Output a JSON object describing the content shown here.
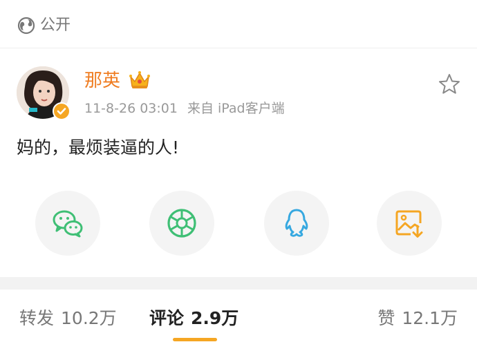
{
  "header": {
    "visibility_icon": "globe-icon",
    "visibility_label": "公开"
  },
  "post": {
    "username": "那英",
    "badge_icon": "crown-icon",
    "verified_icon": "verified-icon",
    "timestamp": "11-8-26 03:01",
    "source": "来自 iPad客户端",
    "content": "妈的，最烦装逼的人!"
  },
  "share_buttons": [
    {
      "icon": "wechat-icon"
    },
    {
      "icon": "moments-icon"
    },
    {
      "icon": "qq-icon"
    },
    {
      "icon": "save-image-icon"
    }
  ],
  "tabs": {
    "repost_label": "转发",
    "repost_count": "10.2万",
    "comment_label": "评论",
    "comment_count": "2.9万",
    "like_label": "赞",
    "like_count": "12.1万",
    "active": "comment"
  },
  "colors": {
    "accent": "#f5a623",
    "username": "#ef7d22",
    "wechat": "#3fbf75",
    "qq": "#36a8e0"
  }
}
